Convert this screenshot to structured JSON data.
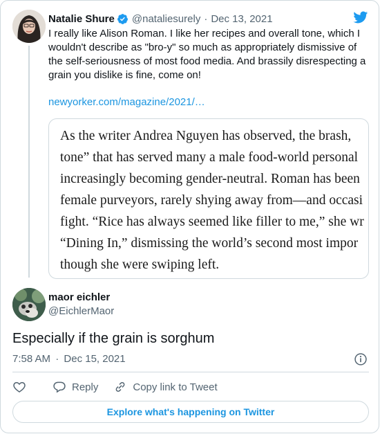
{
  "quoted_tweet": {
    "author_name": "Natalie Shure",
    "handle": "@nataliesurely",
    "separator": "·",
    "date": "Dec 13, 2021",
    "text": "I really like Alison Roman. I like her recipes and overall tone, which I wouldn't describe as \"bro-y\" so much as appropriately dismissive of the self-seriousness of most food media. And brassily disrespecting a grain you dislike is fine, come on!",
    "link": "newyorker.com/magazine/2021/…",
    "excerpt_lines": [
      "As the writer Andrea Nguyen has observed, the brash,",
      "tone” that has served many a male food-world personal",
      "increasingly becoming gender-neutral. Roman has been",
      "female purveyors, rarely shying away from—and occasi",
      "fight. “Rice has always seemed like filler to me,” she wr",
      "“Dining In,” dismissing the world’s second most impor",
      "though she were swiping left."
    ]
  },
  "tweet": {
    "author_name": "maor eichler",
    "handle": "@EichlerMaor",
    "text": "Especially if the grain is sorghum",
    "time": "7:58 AM",
    "separator": "·",
    "date": "Dec 15, 2021"
  },
  "actions": {
    "reply_label": "Reply",
    "copy_link_label": "Copy link to Tweet"
  },
  "explore_label": "Explore what's happening on Twitter",
  "icons": {
    "brand": "twitter-bird-icon",
    "verified": "verified-badge-icon",
    "like": "heart-icon",
    "reply": "reply-bubble-icon",
    "copy_link": "link-icon",
    "info": "info-icon"
  },
  "colors": {
    "link": "#1b95e0",
    "twitter_blue": "#1d9bf0",
    "muted_text": "#536471",
    "border": "#cfd9de"
  }
}
